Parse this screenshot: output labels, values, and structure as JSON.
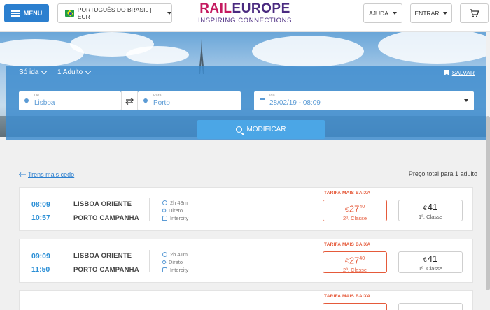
{
  "header": {
    "menu_label": "MENU",
    "language_label": "PORTUGUÊS DO BRASIL | EUR",
    "logo": {
      "part1": "RAIL",
      "part2": "EUROPE",
      "tagline": "INSPIRING CONNECTIONS"
    },
    "help_label": "AJUDA",
    "login_label": "ENTRAR"
  },
  "search": {
    "trip_type": "Só ida",
    "passengers": "1 Adulto",
    "save_label": "SALVAR",
    "from_label": "De",
    "from_value": "Lisboa",
    "to_label": "Para",
    "to_value": "Porto",
    "date_label": "Ida",
    "date_value": "28/02/19 - 08:09",
    "modify_label": "MODIFICAR"
  },
  "results": {
    "earlier_link": "Trens mais cedo",
    "price_note": "Preço total para 1 adulto",
    "trips": [
      {
        "depart": "08:09",
        "arrive": "10:57",
        "from": "LISBOA ORIENTE",
        "to": "PORTO CAMPANHA",
        "duration": "2h 48m",
        "type": "Direto",
        "train": "Intercity",
        "lowest_label": "TARIFA MAIS BAIXA",
        "fare2_currency": "€",
        "fare2_int": "27",
        "fare2_dec": "40",
        "fare2_class": "2ª. Classe",
        "fare1_currency": "€",
        "fare1_int": "41",
        "fare1_class": "1ª. Classe"
      },
      {
        "depart": "09:09",
        "arrive": "11:50",
        "from": "LISBOA ORIENTE",
        "to": "PORTO CAMPANHA",
        "duration": "2h 41m",
        "type": "Direto",
        "train": "Intercity",
        "lowest_label": "TARIFA MAIS BAIXA",
        "fare2_currency": "€",
        "fare2_int": "27",
        "fare2_dec": "40",
        "fare2_class": "2ª. Classe",
        "fare1_currency": "€",
        "fare1_int": "41",
        "fare1_class": "1ª. Classe"
      }
    ],
    "partial_lowest_label": "TARIFA MAIS BAIXA"
  },
  "colors": {
    "brand_blue": "#2b7fcf",
    "accent_orange": "#e55a3a",
    "logo_magenta": "#c4195f",
    "logo_purple": "#4a2a80"
  },
  "icons": [
    "hamburger-icon",
    "brazil-flag-icon",
    "cart-icon",
    "pin-icon",
    "swap-icon",
    "calendar-icon",
    "search-icon",
    "bookmark-icon",
    "clock-icon",
    "route-icon",
    "train-icon"
  ]
}
